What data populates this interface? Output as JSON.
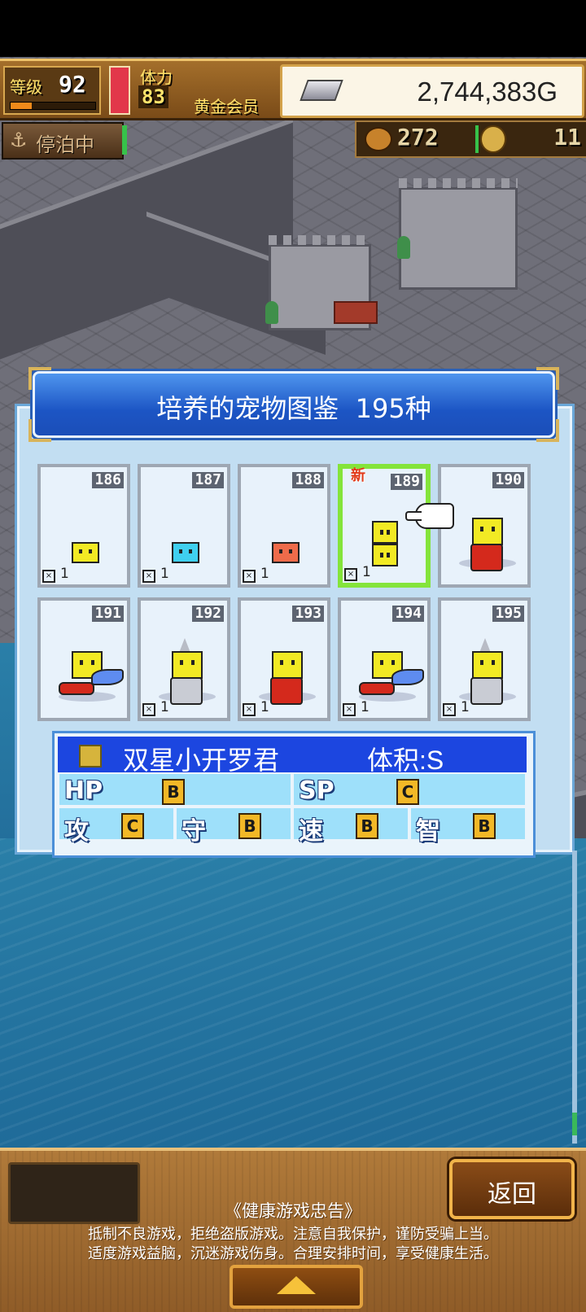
{
  "hud": {
    "level_label": "等级",
    "level_value": "92",
    "level_progress": 0.25,
    "stamina_label": "体力",
    "stamina_value": "83",
    "stamina_fill": 1.0,
    "member_label": "黄金会员",
    "gold_value": "2,744,383G",
    "dock_label": "停泊中",
    "dock_icon": "anchor-icon",
    "bread_value": "272",
    "coin_value": "11"
  },
  "dialog": {
    "title": "培养的宠物图鉴  195种",
    "new_tag": "新",
    "cards": [
      {
        "num": "186",
        "count": "1",
        "pet": "small-yellow"
      },
      {
        "num": "187",
        "count": "1",
        "pet": "small-cyan"
      },
      {
        "num": "188",
        "count": "1",
        "pet": "small-red"
      },
      {
        "num": "189",
        "count": "1",
        "pet": "twin-yellow",
        "selected": true,
        "new": true
      },
      {
        "num": "190",
        "count": "",
        "pet": "robot-red"
      },
      {
        "num": "191",
        "count": "",
        "pet": "flyer"
      },
      {
        "num": "192",
        "count": "1",
        "pet": "drill"
      },
      {
        "num": "193",
        "count": "1",
        "pet": "robot-red"
      },
      {
        "num": "194",
        "count": "1",
        "pet": "flyer"
      },
      {
        "num": "195",
        "count": "1",
        "pet": "drill"
      }
    ]
  },
  "info": {
    "name": "双星小开罗君",
    "size": "体积:S",
    "stats": {
      "hp_label": "HP",
      "hp_grade": "B",
      "sp_label": "SP",
      "sp_grade": "C",
      "atk_label": "攻",
      "atk_grade": "C",
      "def_label": "守",
      "def_grade": "B",
      "spd_label": "速",
      "spd_grade": "B",
      "int_label": "智",
      "int_grade": "B"
    }
  },
  "bottom": {
    "back_label": "返回",
    "notice_title": "《健康游戏忠告》",
    "notice_line1": "抵制不良游戏，拒绝盗版游戏。注意自我保护，谨防受骗上当。",
    "notice_line2": "适度游戏益脑，沉迷游戏伤身。合理安排时间，享受健康生活。"
  },
  "colors": {
    "dialog_header": "#1c55c4",
    "selected_border": "#84e43a",
    "info_header": "#1c46e0",
    "stat_cell": "#9ee0fa",
    "grade_badge": "#f2b827"
  }
}
